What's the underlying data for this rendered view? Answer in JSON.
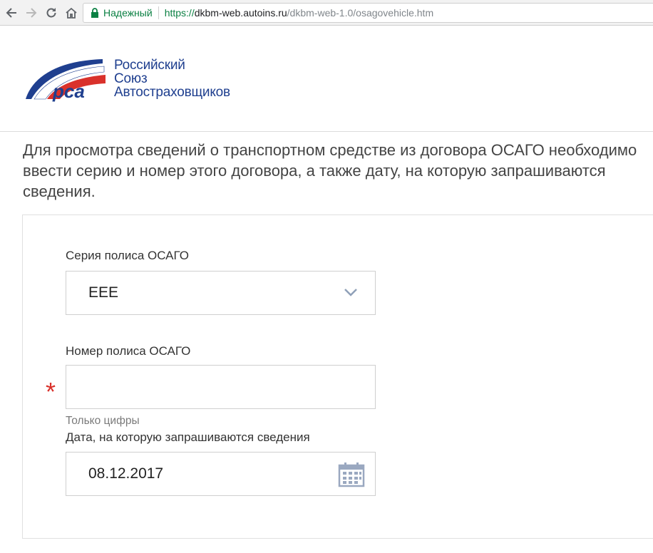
{
  "browser": {
    "secure_label": "Надежный",
    "url_scheme": "https://",
    "url_host": "dkbm-web.autoins.ru",
    "url_path": "/dkbm-web-1.0/osagovehicle.htm"
  },
  "header": {
    "logo_mark": "рса",
    "logo_lines": [
      "Российский",
      "Союз",
      "Автостраховщиков"
    ]
  },
  "intro": {
    "text": "Для просмотра сведений о транспортном средстве из договора ОСАГО необходимо ввести серию и номер этого договора, а также дату, на которую запрашиваются сведения."
  },
  "form": {
    "series_label": "Серия полиса ОСАГО",
    "series_value": "ЕЕЕ",
    "number_label": "Номер полиса ОСАГО",
    "number_value": "",
    "required_mark": "*",
    "number_hint": "Только цифры",
    "date_label": "Дата, на которую запрашиваются сведения",
    "date_value": "08.12.2017"
  },
  "colors": {
    "brand_blue": "#1f3f8f",
    "brand_red": "#d9312b",
    "secure_green": "#0b8043"
  },
  "icons": [
    "back-arrow-icon",
    "forward-arrow-icon",
    "reload-icon",
    "home-icon",
    "lock-icon",
    "chevron-down-icon",
    "calendar-icon"
  ]
}
